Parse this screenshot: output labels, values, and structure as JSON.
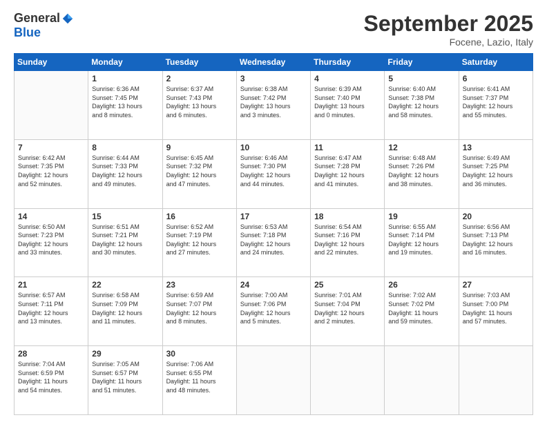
{
  "logo": {
    "general": "General",
    "blue": "Blue"
  },
  "title": "September 2025",
  "subtitle": "Focene, Lazio, Italy",
  "days_of_week": [
    "Sunday",
    "Monday",
    "Tuesday",
    "Wednesday",
    "Thursday",
    "Friday",
    "Saturday"
  ],
  "weeks": [
    [
      {
        "day": "",
        "info": ""
      },
      {
        "day": "1",
        "info": "Sunrise: 6:36 AM\nSunset: 7:45 PM\nDaylight: 13 hours\nand 8 minutes."
      },
      {
        "day": "2",
        "info": "Sunrise: 6:37 AM\nSunset: 7:43 PM\nDaylight: 13 hours\nand 6 minutes."
      },
      {
        "day": "3",
        "info": "Sunrise: 6:38 AM\nSunset: 7:42 PM\nDaylight: 13 hours\nand 3 minutes."
      },
      {
        "day": "4",
        "info": "Sunrise: 6:39 AM\nSunset: 7:40 PM\nDaylight: 13 hours\nand 0 minutes."
      },
      {
        "day": "5",
        "info": "Sunrise: 6:40 AM\nSunset: 7:38 PM\nDaylight: 12 hours\nand 58 minutes."
      },
      {
        "day": "6",
        "info": "Sunrise: 6:41 AM\nSunset: 7:37 PM\nDaylight: 12 hours\nand 55 minutes."
      }
    ],
    [
      {
        "day": "7",
        "info": "Sunrise: 6:42 AM\nSunset: 7:35 PM\nDaylight: 12 hours\nand 52 minutes."
      },
      {
        "day": "8",
        "info": "Sunrise: 6:44 AM\nSunset: 7:33 PM\nDaylight: 12 hours\nand 49 minutes."
      },
      {
        "day": "9",
        "info": "Sunrise: 6:45 AM\nSunset: 7:32 PM\nDaylight: 12 hours\nand 47 minutes."
      },
      {
        "day": "10",
        "info": "Sunrise: 6:46 AM\nSunset: 7:30 PM\nDaylight: 12 hours\nand 44 minutes."
      },
      {
        "day": "11",
        "info": "Sunrise: 6:47 AM\nSunset: 7:28 PM\nDaylight: 12 hours\nand 41 minutes."
      },
      {
        "day": "12",
        "info": "Sunrise: 6:48 AM\nSunset: 7:26 PM\nDaylight: 12 hours\nand 38 minutes."
      },
      {
        "day": "13",
        "info": "Sunrise: 6:49 AM\nSunset: 7:25 PM\nDaylight: 12 hours\nand 36 minutes."
      }
    ],
    [
      {
        "day": "14",
        "info": "Sunrise: 6:50 AM\nSunset: 7:23 PM\nDaylight: 12 hours\nand 33 minutes."
      },
      {
        "day": "15",
        "info": "Sunrise: 6:51 AM\nSunset: 7:21 PM\nDaylight: 12 hours\nand 30 minutes."
      },
      {
        "day": "16",
        "info": "Sunrise: 6:52 AM\nSunset: 7:19 PM\nDaylight: 12 hours\nand 27 minutes."
      },
      {
        "day": "17",
        "info": "Sunrise: 6:53 AM\nSunset: 7:18 PM\nDaylight: 12 hours\nand 24 minutes."
      },
      {
        "day": "18",
        "info": "Sunrise: 6:54 AM\nSunset: 7:16 PM\nDaylight: 12 hours\nand 22 minutes."
      },
      {
        "day": "19",
        "info": "Sunrise: 6:55 AM\nSunset: 7:14 PM\nDaylight: 12 hours\nand 19 minutes."
      },
      {
        "day": "20",
        "info": "Sunrise: 6:56 AM\nSunset: 7:13 PM\nDaylight: 12 hours\nand 16 minutes."
      }
    ],
    [
      {
        "day": "21",
        "info": "Sunrise: 6:57 AM\nSunset: 7:11 PM\nDaylight: 12 hours\nand 13 minutes."
      },
      {
        "day": "22",
        "info": "Sunrise: 6:58 AM\nSunset: 7:09 PM\nDaylight: 12 hours\nand 11 minutes."
      },
      {
        "day": "23",
        "info": "Sunrise: 6:59 AM\nSunset: 7:07 PM\nDaylight: 12 hours\nand 8 minutes."
      },
      {
        "day": "24",
        "info": "Sunrise: 7:00 AM\nSunset: 7:06 PM\nDaylight: 12 hours\nand 5 minutes."
      },
      {
        "day": "25",
        "info": "Sunrise: 7:01 AM\nSunset: 7:04 PM\nDaylight: 12 hours\nand 2 minutes."
      },
      {
        "day": "26",
        "info": "Sunrise: 7:02 AM\nSunset: 7:02 PM\nDaylight: 11 hours\nand 59 minutes."
      },
      {
        "day": "27",
        "info": "Sunrise: 7:03 AM\nSunset: 7:00 PM\nDaylight: 11 hours\nand 57 minutes."
      }
    ],
    [
      {
        "day": "28",
        "info": "Sunrise: 7:04 AM\nSunset: 6:59 PM\nDaylight: 11 hours\nand 54 minutes."
      },
      {
        "day": "29",
        "info": "Sunrise: 7:05 AM\nSunset: 6:57 PM\nDaylight: 11 hours\nand 51 minutes."
      },
      {
        "day": "30",
        "info": "Sunrise: 7:06 AM\nSunset: 6:55 PM\nDaylight: 11 hours\nand 48 minutes."
      },
      {
        "day": "",
        "info": ""
      },
      {
        "day": "",
        "info": ""
      },
      {
        "day": "",
        "info": ""
      },
      {
        "day": "",
        "info": ""
      }
    ]
  ]
}
